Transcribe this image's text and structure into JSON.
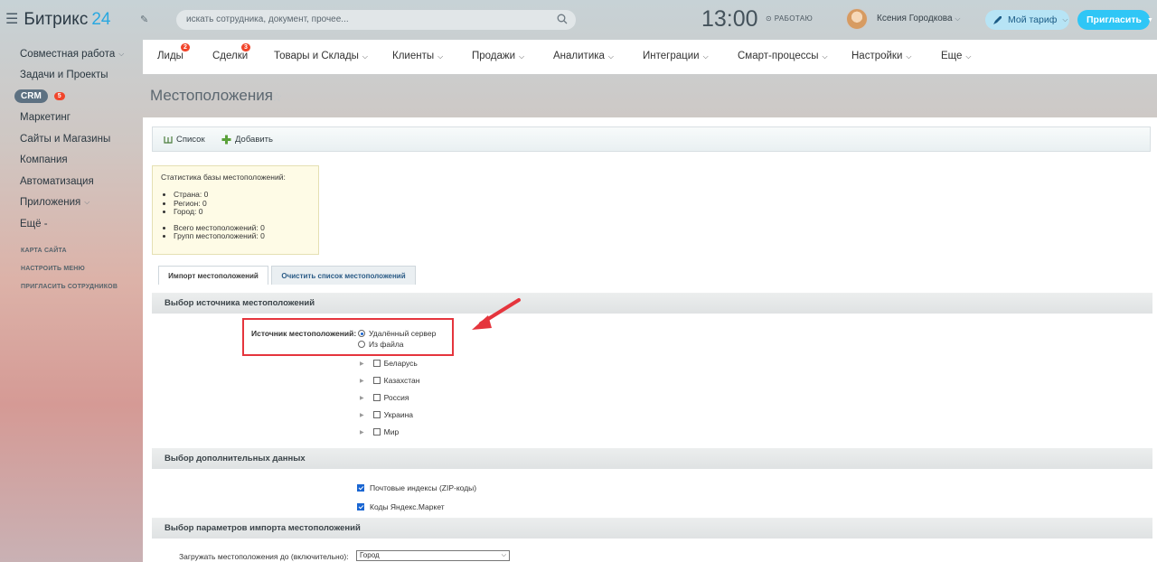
{
  "header": {
    "logo_text": "Битрикс",
    "logo_number": "24",
    "search_placeholder": "искать сотрудника, документ, прочее...",
    "clock": "13:00",
    "work_status": "РАБОТАЮ",
    "user_name": "Ксения Городкова",
    "tariff_label": "Мой тариф",
    "invite_label": "Пригласить"
  },
  "sidebar": {
    "items": [
      {
        "label": "Совместная работа",
        "chevron": true
      },
      {
        "label": "Задачи и Проекты"
      },
      {
        "label": "CRM",
        "badge": "5"
      },
      {
        "label": "Маркетинг"
      },
      {
        "label": "Сайты и Магазины"
      },
      {
        "label": "Компания"
      },
      {
        "label": "Автоматизация"
      },
      {
        "label": "Приложения",
        "chevron": true
      },
      {
        "label": "Ещё -"
      }
    ],
    "links": [
      "КАРТА САЙТА",
      "НАСТРОИТЬ МЕНЮ",
      "ПРИГЛАСИТЬ СОТРУДНИКОВ"
    ]
  },
  "topnav": {
    "items": [
      {
        "label": "Лиды",
        "badge": "2"
      },
      {
        "label": "Сделки",
        "badge": "3"
      },
      {
        "label": "Товары и Склады",
        "chevron": true
      },
      {
        "label": "Клиенты",
        "chevron": true
      },
      {
        "label": "Продажи",
        "chevron": true
      },
      {
        "label": "Аналитика",
        "chevron": true
      },
      {
        "label": "Интеграции",
        "chevron": true
      },
      {
        "label": "Смарт-процессы",
        "chevron": true
      },
      {
        "label": "Настройки",
        "chevron": true
      },
      {
        "label": "Еще",
        "chevron": true
      }
    ]
  },
  "page": {
    "title": "Местоположения",
    "toolbar": {
      "list_label": "Список",
      "add_label": "Добавить"
    },
    "stats": {
      "title": "Статистика базы местоположений:",
      "items": [
        "Страна: 0",
        "Регион: 0",
        "Город: 0"
      ],
      "totals": [
        "Всего местоположений: 0",
        "Групп местоположений: 0"
      ]
    },
    "tabs": [
      "Импорт местоположений",
      "Очистить список местоположений"
    ],
    "sections": {
      "source": "Выбор источника местоположений",
      "additional": "Выбор дополнительных данных",
      "params": "Выбор параметров импорта местоположений"
    },
    "source_label": "Источник местоположений:",
    "source_options": [
      "Удалённый сервер",
      "Из файла"
    ],
    "selected_source": "Удалённый сервер",
    "countries": [
      "Беларусь",
      "Казахстан",
      "Россия",
      "Украина",
      "Мир"
    ],
    "additional_options": [
      {
        "label": "Почтовые индексы (ZIP-коды)",
        "checked": true
      },
      {
        "label": "Коды Яндекс.Маркет",
        "checked": true
      }
    ],
    "load_label": "Загружать местоположения до (включительно):",
    "load_value": "Город"
  },
  "colors": {
    "accent": "#2fc6f6",
    "highlight": "#e5353d",
    "badge": "#f1452b"
  }
}
